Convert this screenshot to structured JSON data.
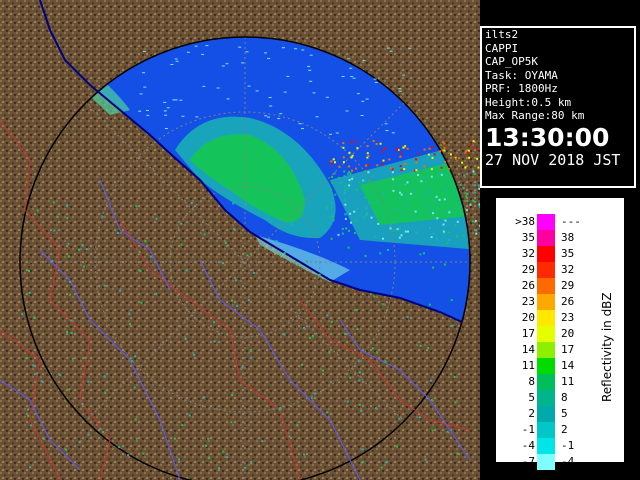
{
  "radar_info": {
    "site": "ilts2",
    "product": "CAPPI",
    "product_code": "CAP_OP5K",
    "task": "Task: OYAMA",
    "prf": "PRF: 1800Hz",
    "height": "Height:0.5 km",
    "max_range": "Max Range:80 km",
    "time": "13:30:00",
    "date": "27 NOV 2018 JST"
  },
  "legend": {
    "caption": "Reflectivity in dBZ",
    "rows": [
      {
        "lo": ">38",
        "hi": "---",
        "color": "#ff00ff"
      },
      {
        "lo": "35",
        "hi": "38",
        "color": "#ff00a0"
      },
      {
        "lo": "32",
        "hi": "35",
        "color": "#ff0000"
      },
      {
        "lo": "29",
        "hi": "32",
        "color": "#ff2a00"
      },
      {
        "lo": "26",
        "hi": "29",
        "color": "#ff6a00"
      },
      {
        "lo": "23",
        "hi": "26",
        "color": "#ffa800"
      },
      {
        "lo": "20",
        "hi": "23",
        "color": "#ffe800"
      },
      {
        "lo": "17",
        "hi": "20",
        "color": "#e4ff00"
      },
      {
        "lo": "14",
        "hi": "17",
        "color": "#8cf000"
      },
      {
        "lo": "11",
        "hi": "14",
        "color": "#00dc00"
      },
      {
        "lo": "8",
        "hi": "11",
        "color": "#00be5a"
      },
      {
        "lo": "5",
        "hi": "8",
        "color": "#00b48c"
      },
      {
        "lo": "2",
        "hi": "5",
        "color": "#00aaaa"
      },
      {
        "lo": "-1",
        "hi": "2",
        "color": "#00c8c8"
      },
      {
        "lo": "-4",
        "hi": "-1",
        "color": "#00e6e6"
      },
      {
        "lo": "-7",
        "hi": "-4",
        "color": "#80ffff"
      }
    ]
  },
  "map": {
    "terrain_color": "#6b5236",
    "sea_color": "#1450e6",
    "coastline_color": "#000080",
    "river_color": "#5a5aff",
    "border_color": "#c83232",
    "range_ring_color": "#808080"
  }
}
